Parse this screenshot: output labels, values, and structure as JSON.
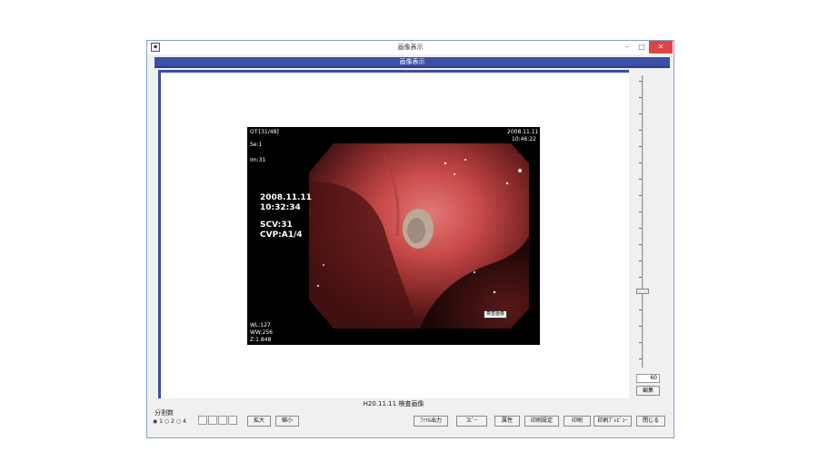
{
  "window": {
    "title": "画像表示",
    "controls": {
      "minimize": "–",
      "maximize": "□",
      "close": "✕"
    }
  },
  "header": {
    "title": "画像表示"
  },
  "image": {
    "overlay": {
      "top_left": [
        "OT:[31/48]",
        "Se:1",
        "Im:31"
      ],
      "top_right_date": "2008.11.11",
      "top_right_time": "10:46:22",
      "date": "2008.11.11",
      "time": "10:32:34",
      "scv": "SCV:31",
      "cvp": "CVP:A1/4",
      "bottom_left": [
        "WL:127",
        "WW:256",
        "Z:1.848"
      ],
      "lesion_label": "検査画像"
    }
  },
  "caption": "H20.11.11 検査画像",
  "zoom": {
    "value": "60",
    "edit_label": "編集"
  },
  "split": {
    "label": "分割数",
    "options": [
      "1",
      "2",
      "4"
    ],
    "selected": "1"
  },
  "buttons": {
    "zoom_in": "拡大",
    "zoom_out": "縮小",
    "file_output": "ﾌｧｲﾙ出力",
    "copy": "ｺﾋﾟｰ",
    "properties": "属性",
    "print_settings": "印刷設定",
    "print": "印刷",
    "print_preview": "印刷ﾌﾟﾚﾋﾞｭｰ",
    "close": "閉じる"
  },
  "colors": {
    "header_blue": "#3a4fa8",
    "close_red": "#e04343",
    "window_bg": "#f0f0f0"
  }
}
